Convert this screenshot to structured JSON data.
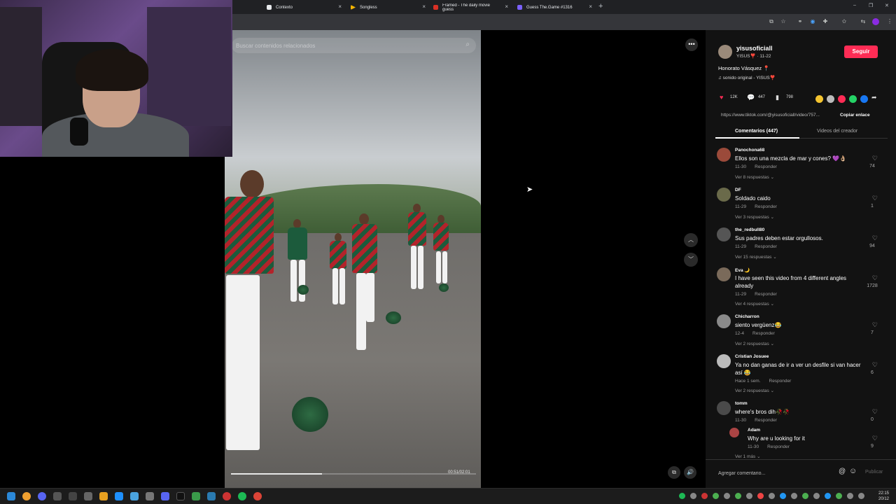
{
  "browser": {
    "tabs": [
      {
        "label": "Contexto",
        "icon": "contexto-favicon-icon",
        "color": "#5f6368"
      },
      {
        "label": "Songless",
        "icon": "songless-favicon-icon",
        "color": "#f4b400"
      },
      {
        "label": "Framed - The daily movie guess",
        "icon": "framed-favicon-icon",
        "color": "#d93025"
      },
      {
        "label": "Guess The.Game #1316",
        "icon": "guessthegame-favicon-icon",
        "color": "#7b61ff"
      }
    ],
    "new_tab_glyph": "+",
    "close_glyph": "×",
    "window_controls": [
      "–",
      "❐",
      "✕"
    ]
  },
  "video": {
    "search_placeholder": "Buscar contenidos relacionados",
    "timecode": "00:51/02:01",
    "progress": 0.37
  },
  "creator": {
    "username": "yisusoficiall",
    "subline": "YISUS❣️ · 11-22",
    "follow_label": "Seguir",
    "caption": "Honorato Vásquez 📍",
    "sound": "♫  sonido original - YISUS❣️",
    "stats": {
      "likes": "12K",
      "comments": "447",
      "saves": "798"
    },
    "link": "https://www.tiktok.com/@yisusoficiall/video/757...",
    "copy_link_label": "Copiar enlace",
    "tabs": [
      "Comentarios (447)",
      "Videos del creador"
    ]
  },
  "comments": [
    {
      "user": "Panochona68",
      "text": "Ellos son una mezcla de mar y cones? 💜👌🏼",
      "date": "11-30",
      "reply": "Responder",
      "more": "Ver 8 respuestas ⌄",
      "likes": "74",
      "color": "#9b4a3a"
    },
    {
      "user": "DF",
      "text": "Soldado caido",
      "date": "11-29",
      "reply": "Responder",
      "more": "Ver 3 respuestas ⌄",
      "likes": "1",
      "color": "#6a6a4a"
    },
    {
      "user": "the_redbull80",
      "text": "Sus padres deben estar orgullosos.",
      "date": "11-29",
      "reply": "Responder",
      "more": "Ver 15 respuestas ⌄",
      "likes": "94",
      "color": "#555"
    },
    {
      "user": "Eva 🌙",
      "text": "I have seen this video from 4 different angles already",
      "date": "11-29",
      "reply": "Responder",
      "more": "Ver 4 respuestas ⌄",
      "likes": "1728",
      "color": "#7a6a5a"
    },
    {
      "user": "Chicharron",
      "text": "siento vergüenz😂",
      "date": "12-4",
      "reply": "Responder",
      "more": "Ver 2 respuestas ⌄",
      "likes": "7",
      "color": "#8a8a8a"
    },
    {
      "user": "Cristian Josuee",
      "text": "Ya no dan ganas de ir a ver un desfile si van hacer así 😂",
      "date": "Hace 1 sem.",
      "reply": "Responder",
      "more": "Ver 2 respuestas ⌄",
      "likes": "6",
      "color": "#bbb"
    },
    {
      "user": "tomm",
      "text": "where's bros dih🥀🥀",
      "date": "11-30",
      "reply": "Responder",
      "more": "",
      "likes": "0",
      "color": "#4a4a4a"
    }
  ],
  "reply_comment": {
    "user": "Adam",
    "text": "Why are u looking for it",
    "date": "11-30",
    "reply": "Responder",
    "likes": "9",
    "color": "#a44"
  },
  "partial_more": "Ver 1 más ⌄",
  "comment_input": {
    "placeholder": "Agregar comentario...",
    "post_label": "Publicar",
    "mention_glyph": "@",
    "emoji_glyph": "☺"
  },
  "taskbar": {
    "time": "22:15",
    "date": "20/12"
  }
}
